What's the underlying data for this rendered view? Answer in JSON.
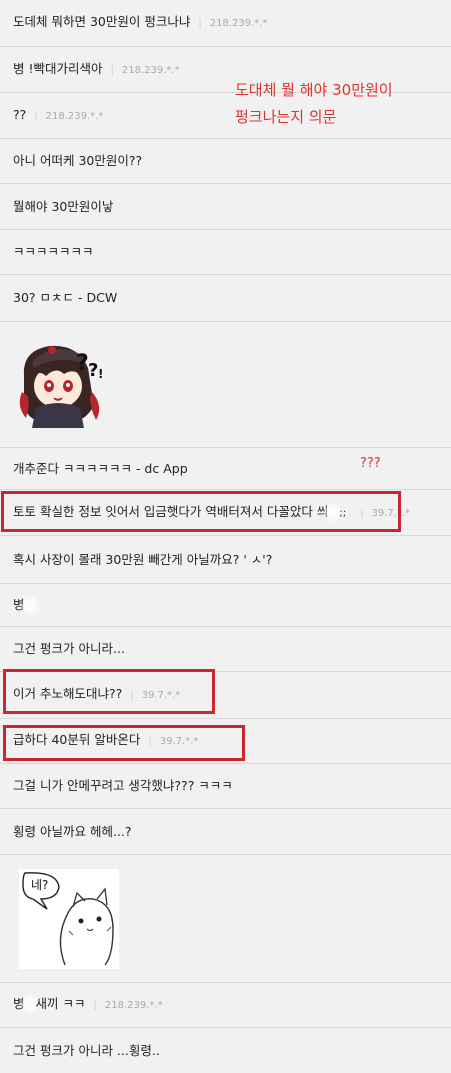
{
  "comments": [
    {
      "text": "도데체 뭐하면 30만원이 펑크나냐",
      "meta": "218.239.*.*"
    },
    {
      "text": "병 !빡대가리색아",
      "meta": "218.239.*.*"
    },
    {
      "text": "??",
      "meta": "218.239.*.*"
    },
    {
      "text": "아니 어떠케 30만원이??",
      "meta": ""
    },
    {
      "text": "뭘해야 30만원이낳",
      "meta": ""
    },
    {
      "text": "ㅋㅋㅋㅋㅋㅋㅋ",
      "meta": ""
    },
    {
      "text": "30? ㅁㅊㄷ - DCW",
      "meta": ""
    },
    {
      "text": "개추준다 ㅋㅋㅋㅋㅋㅋ - dc App",
      "meta": ""
    },
    {
      "text": "토토 확실한 정보 잇어서 입금햇다가 역배터져서 다꼴았다 씌",
      "suffix": ";;",
      "meta": "39.7.*.*"
    },
    {
      "text": "혹시 사장이 몰래 30만원 빼간게 아닐까요? ' ㅅ'?",
      "meta": ""
    },
    {
      "text": "병",
      "meta": ""
    },
    {
      "text": "그건 펑크가 아니라...",
      "meta": ""
    },
    {
      "text": "이거 추노해도대냐??",
      "meta": "39.7.*.*"
    },
    {
      "text": "급하다 40분뒤 알바온다",
      "meta": "39.7.*.*"
    },
    {
      "text": "그걸 니가 안메꾸려고 생각했냐??? ㅋㅋㅋ",
      "meta": ""
    },
    {
      "text": "횡령 아닐까요 헤헤...?",
      "meta": ""
    },
    {
      "text": "병",
      "suffix": "새끼 ㅋㅋ",
      "meta": "218.239.*.*"
    },
    {
      "text": "그건 펑크가 아니라 ...횡령..",
      "meta": ""
    }
  ],
  "annotations": {
    "top_line1": "도대체 뭘 해야 30만원이",
    "top_line2": "펑크나는지 의문",
    "question_marks": "???"
  },
  "stickers": {
    "cat_bubble": "네?"
  },
  "colors": {
    "background": "#f1f1f1",
    "annotation_red": "#e0332f",
    "box_red": "#c8282e",
    "meta_gray": "#aaaaaa"
  }
}
